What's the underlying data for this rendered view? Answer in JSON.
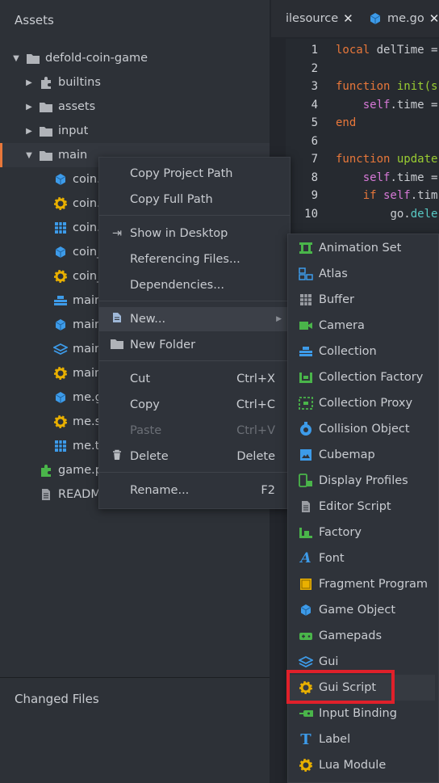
{
  "assets_panel": {
    "title": "Assets",
    "tree": [
      {
        "label": "defold-coin-game",
        "icon": "folder-icon",
        "expanded": true
      },
      {
        "label": "builtins",
        "icon": "puzzle-icon",
        "expanded": false
      },
      {
        "label": "assets",
        "icon": "folder-icon",
        "expanded": false
      },
      {
        "label": "input",
        "icon": "folder-icon",
        "expanded": false
      },
      {
        "label": "main",
        "icon": "folder-icon",
        "expanded": true,
        "selected": true
      },
      {
        "label": "coin.",
        "icon": "game-object-icon"
      },
      {
        "label": "coin.",
        "icon": "script-gear-icon"
      },
      {
        "label": "coin.",
        "icon": "tilesource-grid-icon"
      },
      {
        "label": "coin_",
        "icon": "game-object-icon"
      },
      {
        "label": "coin_",
        "icon": "script-gear-icon"
      },
      {
        "label": "main",
        "icon": "collection-icon"
      },
      {
        "label": "main",
        "icon": "game-object-icon"
      },
      {
        "label": "main",
        "icon": "gui-layers-icon"
      },
      {
        "label": "main",
        "icon": "script-gear-icon"
      },
      {
        "label": "me.g",
        "icon": "game-object-icon"
      },
      {
        "label": "me.s",
        "icon": "script-gear-icon"
      },
      {
        "label": "me.t",
        "icon": "tilesource-grid-icon"
      },
      {
        "label": "game.p",
        "icon": "project-puzzle-icon"
      },
      {
        "label": "READM",
        "icon": "document-icon"
      }
    ]
  },
  "changed_files": {
    "title": "Changed Files"
  },
  "tabs": [
    {
      "label": "ilesource",
      "close": "✕"
    },
    {
      "label": "me.go",
      "close": "✕"
    }
  ],
  "code": {
    "lines": [
      {
        "n": "1"
      },
      {
        "n": "2"
      },
      {
        "n": "3"
      },
      {
        "n": "4"
      },
      {
        "n": "5"
      },
      {
        "n": "6"
      },
      {
        "n": "7"
      },
      {
        "n": "8"
      },
      {
        "n": "9"
      },
      {
        "n": "10"
      }
    ],
    "tokens": {
      "l1_kw": "local",
      "l1_tx": " delTime =",
      "l3_kw": "function",
      "l3_fn": " init(s",
      "l4_self": "self",
      "l4_tx": ".time =",
      "l5_kw": "end",
      "l7_kw": "function",
      "l7_fn": " update",
      "l8_self": "self",
      "l8_tx": ".time =",
      "l9_kw": "if",
      "l9_self": " self",
      "l9_tx": ".tim",
      "l10_tx": "go.",
      "l10_tl": "dele"
    }
  },
  "context_menu": {
    "copy_project_path": "Copy Project Path",
    "copy_full_path": "Copy Full Path",
    "show_in_desktop": "Show in Desktop",
    "referencing_files": "Referencing Files...",
    "dependencies": "Dependencies...",
    "new": "New...",
    "new_folder": "New Folder",
    "cut": "Cut",
    "cut_shortcut": "Ctrl+X",
    "copy": "Copy",
    "copy_shortcut": "Ctrl+C",
    "paste": "Paste",
    "paste_shortcut": "Ctrl+V",
    "delete": "Delete",
    "delete_shortcut": "Delete",
    "rename": "Rename...",
    "rename_shortcut": "F2"
  },
  "new_submenu": [
    {
      "label": "Animation Set",
      "icon": "animation-set-icon"
    },
    {
      "label": "Atlas",
      "icon": "atlas-icon"
    },
    {
      "label": "Buffer",
      "icon": "buffer-icon"
    },
    {
      "label": "Camera",
      "icon": "camera-icon"
    },
    {
      "label": "Collection",
      "icon": "collection-icon"
    },
    {
      "label": "Collection Factory",
      "icon": "collection-factory-icon"
    },
    {
      "label": "Collection Proxy",
      "icon": "collection-proxy-icon"
    },
    {
      "label": "Collision Object",
      "icon": "collision-object-icon"
    },
    {
      "label": "Cubemap",
      "icon": "cubemap-icon"
    },
    {
      "label": "Display Profiles",
      "icon": "display-profiles-icon"
    },
    {
      "label": "Editor Script",
      "icon": "editor-script-icon"
    },
    {
      "label": "Factory",
      "icon": "factory-icon"
    },
    {
      "label": "Font",
      "icon": "font-icon"
    },
    {
      "label": "Fragment Program",
      "icon": "fragment-program-icon"
    },
    {
      "label": "Game Object",
      "icon": "game-object-icon"
    },
    {
      "label": "Gamepads",
      "icon": "gamepads-icon"
    },
    {
      "label": "Gui",
      "icon": "gui-icon"
    },
    {
      "label": "Gui Script",
      "icon": "gui-script-icon"
    },
    {
      "label": "Input Binding",
      "icon": "input-binding-icon"
    },
    {
      "label": "Label",
      "icon": "label-icon"
    },
    {
      "label": "Lua Module",
      "icon": "lua-module-icon"
    }
  ],
  "colors": {
    "accent": "#e8773a",
    "highlight_box": "#e0202a",
    "icon_blue": "#3d9be9",
    "icon_gold": "#e9b000",
    "icon_green": "#4ab54a"
  }
}
